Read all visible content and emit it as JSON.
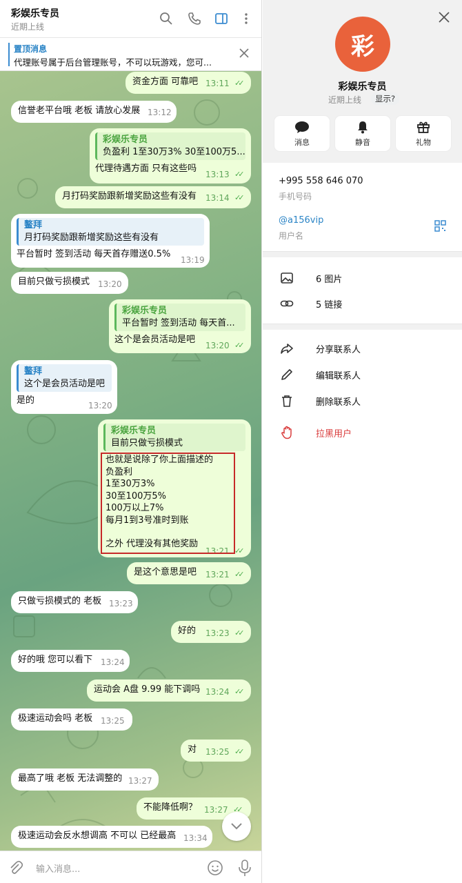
{
  "chat": {
    "title": "彩娱乐专员",
    "status": "近期上线"
  },
  "pinned": {
    "title": "置顶消息",
    "text": "代理账号属于后台管理账号，不可以玩游戏，您可..."
  },
  "messages": [
    {
      "dir": "out",
      "text": "资金方面 可靠吧",
      "time": "13:11"
    },
    {
      "dir": "in",
      "text": "信誉老平台哦 老板 请放心发展",
      "time": "13:12"
    },
    {
      "dir": "out",
      "quote_name": "彩娱乐专员",
      "quote_text": "负盈利 1至30万3% 30至100万5...",
      "text": "代理待遇方面 只有这些吗",
      "time": "13:13"
    },
    {
      "dir": "out",
      "text": "月打码奖励跟新增奖励这些有没有",
      "time": "13:14"
    },
    {
      "dir": "in",
      "quote_name": "鳌拜",
      "quote_text": "月打码奖励跟新增奖励这些有没有",
      "text": "平台暂时  签到活动   每天首存赠送0.5%",
      "time": "13:19"
    },
    {
      "dir": "in",
      "text": "目前只做亏损模式",
      "time": "13:20"
    },
    {
      "dir": "out",
      "quote_name": "彩娱乐专员",
      "quote_text": "平台暂时  签到活动  每天首...",
      "text": "这个是会员活动是吧",
      "time": "13:20"
    },
    {
      "dir": "in",
      "quote_name": "鳌拜",
      "quote_text": "这个是会员活动是吧",
      "text": "是的",
      "time": "13:20"
    },
    {
      "dir": "out",
      "quote_name": "彩娱乐专员",
      "quote_text": "目前只做亏损模式",
      "lines": [
        "也就是说除了你上面描述的",
        "负盈利",
        "1至30万3%",
        "30至100万5%",
        "100万以上7%",
        "每月1到3号准时到账",
        "",
        "之外 代理没有其他奖励"
      ],
      "time": "13:21"
    },
    {
      "dir": "out",
      "text": "是这个意思是吧",
      "time": "13:21"
    },
    {
      "dir": "in",
      "text": "只做亏损模式的 老板",
      "time": "13:23"
    },
    {
      "dir": "out",
      "text": "好的",
      "time": "13:23"
    },
    {
      "dir": "in",
      "text": "好的哦 您可以看下",
      "time": "13:24"
    },
    {
      "dir": "out",
      "text": "运动会 A盘 9.99 能下调吗",
      "time": "13:24"
    },
    {
      "dir": "in",
      "text": "极速运动会吗 老板",
      "time": "13:25"
    },
    {
      "dir": "out",
      "text": "对",
      "time": "13:25"
    },
    {
      "dir": "in",
      "text": "最高了哦 老板 无法调整的",
      "time": "13:27"
    },
    {
      "dir": "out",
      "text": "不能降低啊？",
      "time": "13:27"
    },
    {
      "dir": "in",
      "text": "极速运动会反水想调高 不可以 已经最高",
      "time": "13:34"
    }
  ],
  "input": {
    "placeholder": "输入消息..."
  },
  "profile": {
    "avatar_char": "彩",
    "avatar_color": "#e9623b",
    "name": "彩娱乐专员",
    "status": "近期上线",
    "show_label": "显示?",
    "actions": [
      {
        "label": "消息",
        "icon": "chat-bubble-icon"
      },
      {
        "label": "静音",
        "icon": "bell-icon"
      },
      {
        "label": "礼物",
        "icon": "gift-icon"
      }
    ],
    "phone": "+995 558 646 070",
    "phone_label": "手机号码",
    "username": "@a156vip",
    "username_label": "用户名",
    "media": [
      {
        "label": "6 图片",
        "icon": "image-icon"
      },
      {
        "label": "5 链接",
        "icon": "link-icon"
      }
    ],
    "menu": [
      {
        "label": "分享联系人",
        "icon": "share-icon"
      },
      {
        "label": "编辑联系人",
        "icon": "pencil-icon"
      },
      {
        "label": "删除联系人",
        "icon": "trash-icon"
      },
      {
        "label": "拉黑用户",
        "icon": "hand-stop-icon",
        "color": "#d93a3a"
      }
    ]
  }
}
